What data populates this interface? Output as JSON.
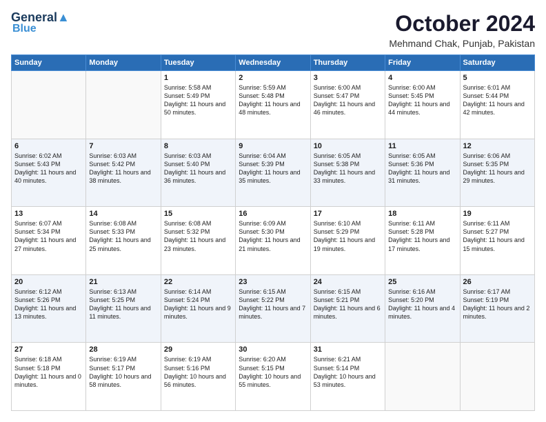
{
  "header": {
    "logo_line1": "General",
    "logo_line2": "Blue",
    "title": "October 2024",
    "subtitle": "Mehmand Chak, Punjab, Pakistan"
  },
  "days_of_week": [
    "Sunday",
    "Monday",
    "Tuesday",
    "Wednesday",
    "Thursday",
    "Friday",
    "Saturday"
  ],
  "weeks": [
    [
      {
        "day": "",
        "sunrise": "",
        "sunset": "",
        "daylight": "",
        "empty": true
      },
      {
        "day": "",
        "sunrise": "",
        "sunset": "",
        "daylight": "",
        "empty": true
      },
      {
        "day": "1",
        "sunrise": "Sunrise: 5:58 AM",
        "sunset": "Sunset: 5:49 PM",
        "daylight": "Daylight: 11 hours and 50 minutes."
      },
      {
        "day": "2",
        "sunrise": "Sunrise: 5:59 AM",
        "sunset": "Sunset: 5:48 PM",
        "daylight": "Daylight: 11 hours and 48 minutes."
      },
      {
        "day": "3",
        "sunrise": "Sunrise: 6:00 AM",
        "sunset": "Sunset: 5:47 PM",
        "daylight": "Daylight: 11 hours and 46 minutes."
      },
      {
        "day": "4",
        "sunrise": "Sunrise: 6:00 AM",
        "sunset": "Sunset: 5:45 PM",
        "daylight": "Daylight: 11 hours and 44 minutes."
      },
      {
        "day": "5",
        "sunrise": "Sunrise: 6:01 AM",
        "sunset": "Sunset: 5:44 PM",
        "daylight": "Daylight: 11 hours and 42 minutes."
      }
    ],
    [
      {
        "day": "6",
        "sunrise": "Sunrise: 6:02 AM",
        "sunset": "Sunset: 5:43 PM",
        "daylight": "Daylight: 11 hours and 40 minutes."
      },
      {
        "day": "7",
        "sunrise": "Sunrise: 6:03 AM",
        "sunset": "Sunset: 5:42 PM",
        "daylight": "Daylight: 11 hours and 38 minutes."
      },
      {
        "day": "8",
        "sunrise": "Sunrise: 6:03 AM",
        "sunset": "Sunset: 5:40 PM",
        "daylight": "Daylight: 11 hours and 36 minutes."
      },
      {
        "day": "9",
        "sunrise": "Sunrise: 6:04 AM",
        "sunset": "Sunset: 5:39 PM",
        "daylight": "Daylight: 11 hours and 35 minutes."
      },
      {
        "day": "10",
        "sunrise": "Sunrise: 6:05 AM",
        "sunset": "Sunset: 5:38 PM",
        "daylight": "Daylight: 11 hours and 33 minutes."
      },
      {
        "day": "11",
        "sunrise": "Sunrise: 6:05 AM",
        "sunset": "Sunset: 5:36 PM",
        "daylight": "Daylight: 11 hours and 31 minutes."
      },
      {
        "day": "12",
        "sunrise": "Sunrise: 6:06 AM",
        "sunset": "Sunset: 5:35 PM",
        "daylight": "Daylight: 11 hours and 29 minutes."
      }
    ],
    [
      {
        "day": "13",
        "sunrise": "Sunrise: 6:07 AM",
        "sunset": "Sunset: 5:34 PM",
        "daylight": "Daylight: 11 hours and 27 minutes."
      },
      {
        "day": "14",
        "sunrise": "Sunrise: 6:08 AM",
        "sunset": "Sunset: 5:33 PM",
        "daylight": "Daylight: 11 hours and 25 minutes."
      },
      {
        "day": "15",
        "sunrise": "Sunrise: 6:08 AM",
        "sunset": "Sunset: 5:32 PM",
        "daylight": "Daylight: 11 hours and 23 minutes."
      },
      {
        "day": "16",
        "sunrise": "Sunrise: 6:09 AM",
        "sunset": "Sunset: 5:30 PM",
        "daylight": "Daylight: 11 hours and 21 minutes."
      },
      {
        "day": "17",
        "sunrise": "Sunrise: 6:10 AM",
        "sunset": "Sunset: 5:29 PM",
        "daylight": "Daylight: 11 hours and 19 minutes."
      },
      {
        "day": "18",
        "sunrise": "Sunrise: 6:11 AM",
        "sunset": "Sunset: 5:28 PM",
        "daylight": "Daylight: 11 hours and 17 minutes."
      },
      {
        "day": "19",
        "sunrise": "Sunrise: 6:11 AM",
        "sunset": "Sunset: 5:27 PM",
        "daylight": "Daylight: 11 hours and 15 minutes."
      }
    ],
    [
      {
        "day": "20",
        "sunrise": "Sunrise: 6:12 AM",
        "sunset": "Sunset: 5:26 PM",
        "daylight": "Daylight: 11 hours and 13 minutes."
      },
      {
        "day": "21",
        "sunrise": "Sunrise: 6:13 AM",
        "sunset": "Sunset: 5:25 PM",
        "daylight": "Daylight: 11 hours and 11 minutes."
      },
      {
        "day": "22",
        "sunrise": "Sunrise: 6:14 AM",
        "sunset": "Sunset: 5:24 PM",
        "daylight": "Daylight: 11 hours and 9 minutes."
      },
      {
        "day": "23",
        "sunrise": "Sunrise: 6:15 AM",
        "sunset": "Sunset: 5:22 PM",
        "daylight": "Daylight: 11 hours and 7 minutes."
      },
      {
        "day": "24",
        "sunrise": "Sunrise: 6:15 AM",
        "sunset": "Sunset: 5:21 PM",
        "daylight": "Daylight: 11 hours and 6 minutes."
      },
      {
        "day": "25",
        "sunrise": "Sunrise: 6:16 AM",
        "sunset": "Sunset: 5:20 PM",
        "daylight": "Daylight: 11 hours and 4 minutes."
      },
      {
        "day": "26",
        "sunrise": "Sunrise: 6:17 AM",
        "sunset": "Sunset: 5:19 PM",
        "daylight": "Daylight: 11 hours and 2 minutes."
      }
    ],
    [
      {
        "day": "27",
        "sunrise": "Sunrise: 6:18 AM",
        "sunset": "Sunset: 5:18 PM",
        "daylight": "Daylight: 11 hours and 0 minutes."
      },
      {
        "day": "28",
        "sunrise": "Sunrise: 6:19 AM",
        "sunset": "Sunset: 5:17 PM",
        "daylight": "Daylight: 10 hours and 58 minutes."
      },
      {
        "day": "29",
        "sunrise": "Sunrise: 6:19 AM",
        "sunset": "Sunset: 5:16 PM",
        "daylight": "Daylight: 10 hours and 56 minutes."
      },
      {
        "day": "30",
        "sunrise": "Sunrise: 6:20 AM",
        "sunset": "Sunset: 5:15 PM",
        "daylight": "Daylight: 10 hours and 55 minutes."
      },
      {
        "day": "31",
        "sunrise": "Sunrise: 6:21 AM",
        "sunset": "Sunset: 5:14 PM",
        "daylight": "Daylight: 10 hours and 53 minutes."
      },
      {
        "day": "",
        "sunrise": "",
        "sunset": "",
        "daylight": "",
        "empty": true
      },
      {
        "day": "",
        "sunrise": "",
        "sunset": "",
        "daylight": "",
        "empty": true
      }
    ]
  ]
}
